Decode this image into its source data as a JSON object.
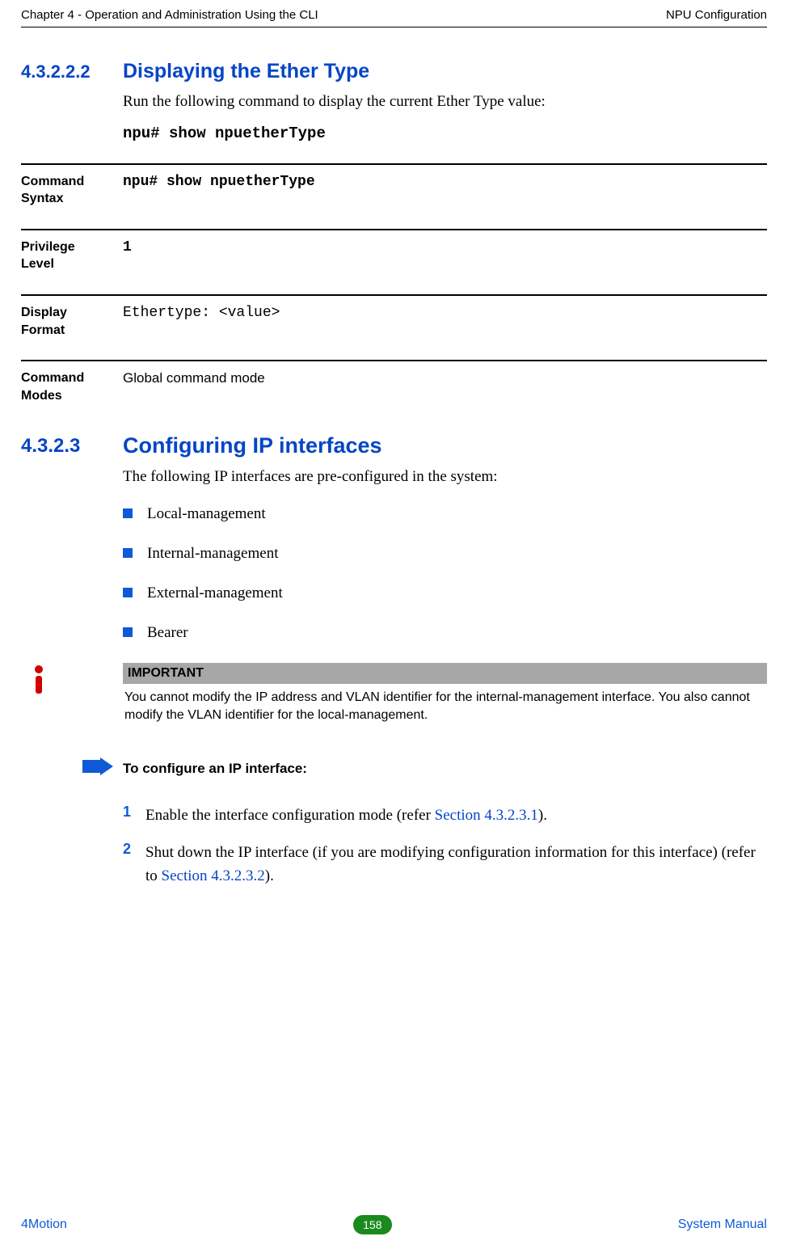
{
  "header": {
    "left": "Chapter 4 - Operation and Administration Using the CLI",
    "right": "NPU Configuration"
  },
  "sec1": {
    "num": "4.3.2.2.2",
    "title": "Displaying the Ether Type",
    "intro": "Run the following command to display the current Ether Type value:",
    "cmd": "npu# show npuetherType"
  },
  "defs": {
    "rows": [
      {
        "left1": "Command",
        "left2": "Syntax",
        "right": "npu# show npuetherType",
        "rstyle": "mono-bold"
      },
      {
        "left1": "Privilege",
        "left2": "Level",
        "right": "1",
        "rstyle": "mono-bold"
      },
      {
        "left1": "Display",
        "left2": "Format",
        "right": "Ethertype: <value>",
        "rstyle": ""
      },
      {
        "left1": "Command",
        "left2": "Modes",
        "right": "Global command mode",
        "rstyle": "sans"
      }
    ]
  },
  "sec2": {
    "num": "4.3.2.3",
    "title": "Configuring IP interfaces",
    "intro": "The following IP interfaces are pre-configured in the system:",
    "bullets": [
      "Local-management",
      "Internal-management",
      "External-management",
      "Bearer"
    ]
  },
  "important": {
    "label": "IMPORTANT",
    "body": "You cannot modify the IP address and VLAN identifier for the internal-management interface. You also cannot modify the VLAN identifier for the local-management."
  },
  "procedure": {
    "title": "To configure an IP interface:"
  },
  "steps": [
    {
      "n": "1",
      "pre": "Enable the interface configuration mode (refer ",
      "link": "Section 4.3.2.3.1",
      "post": ")."
    },
    {
      "n": "2",
      "pre": "Shut down the IP interface (if you are modifying configuration information for this interface) (refer to ",
      "link": "Section 4.3.2.3.2",
      "post": ")."
    }
  ],
  "footer": {
    "left": "4Motion",
    "page": "158",
    "right": "System Manual"
  }
}
